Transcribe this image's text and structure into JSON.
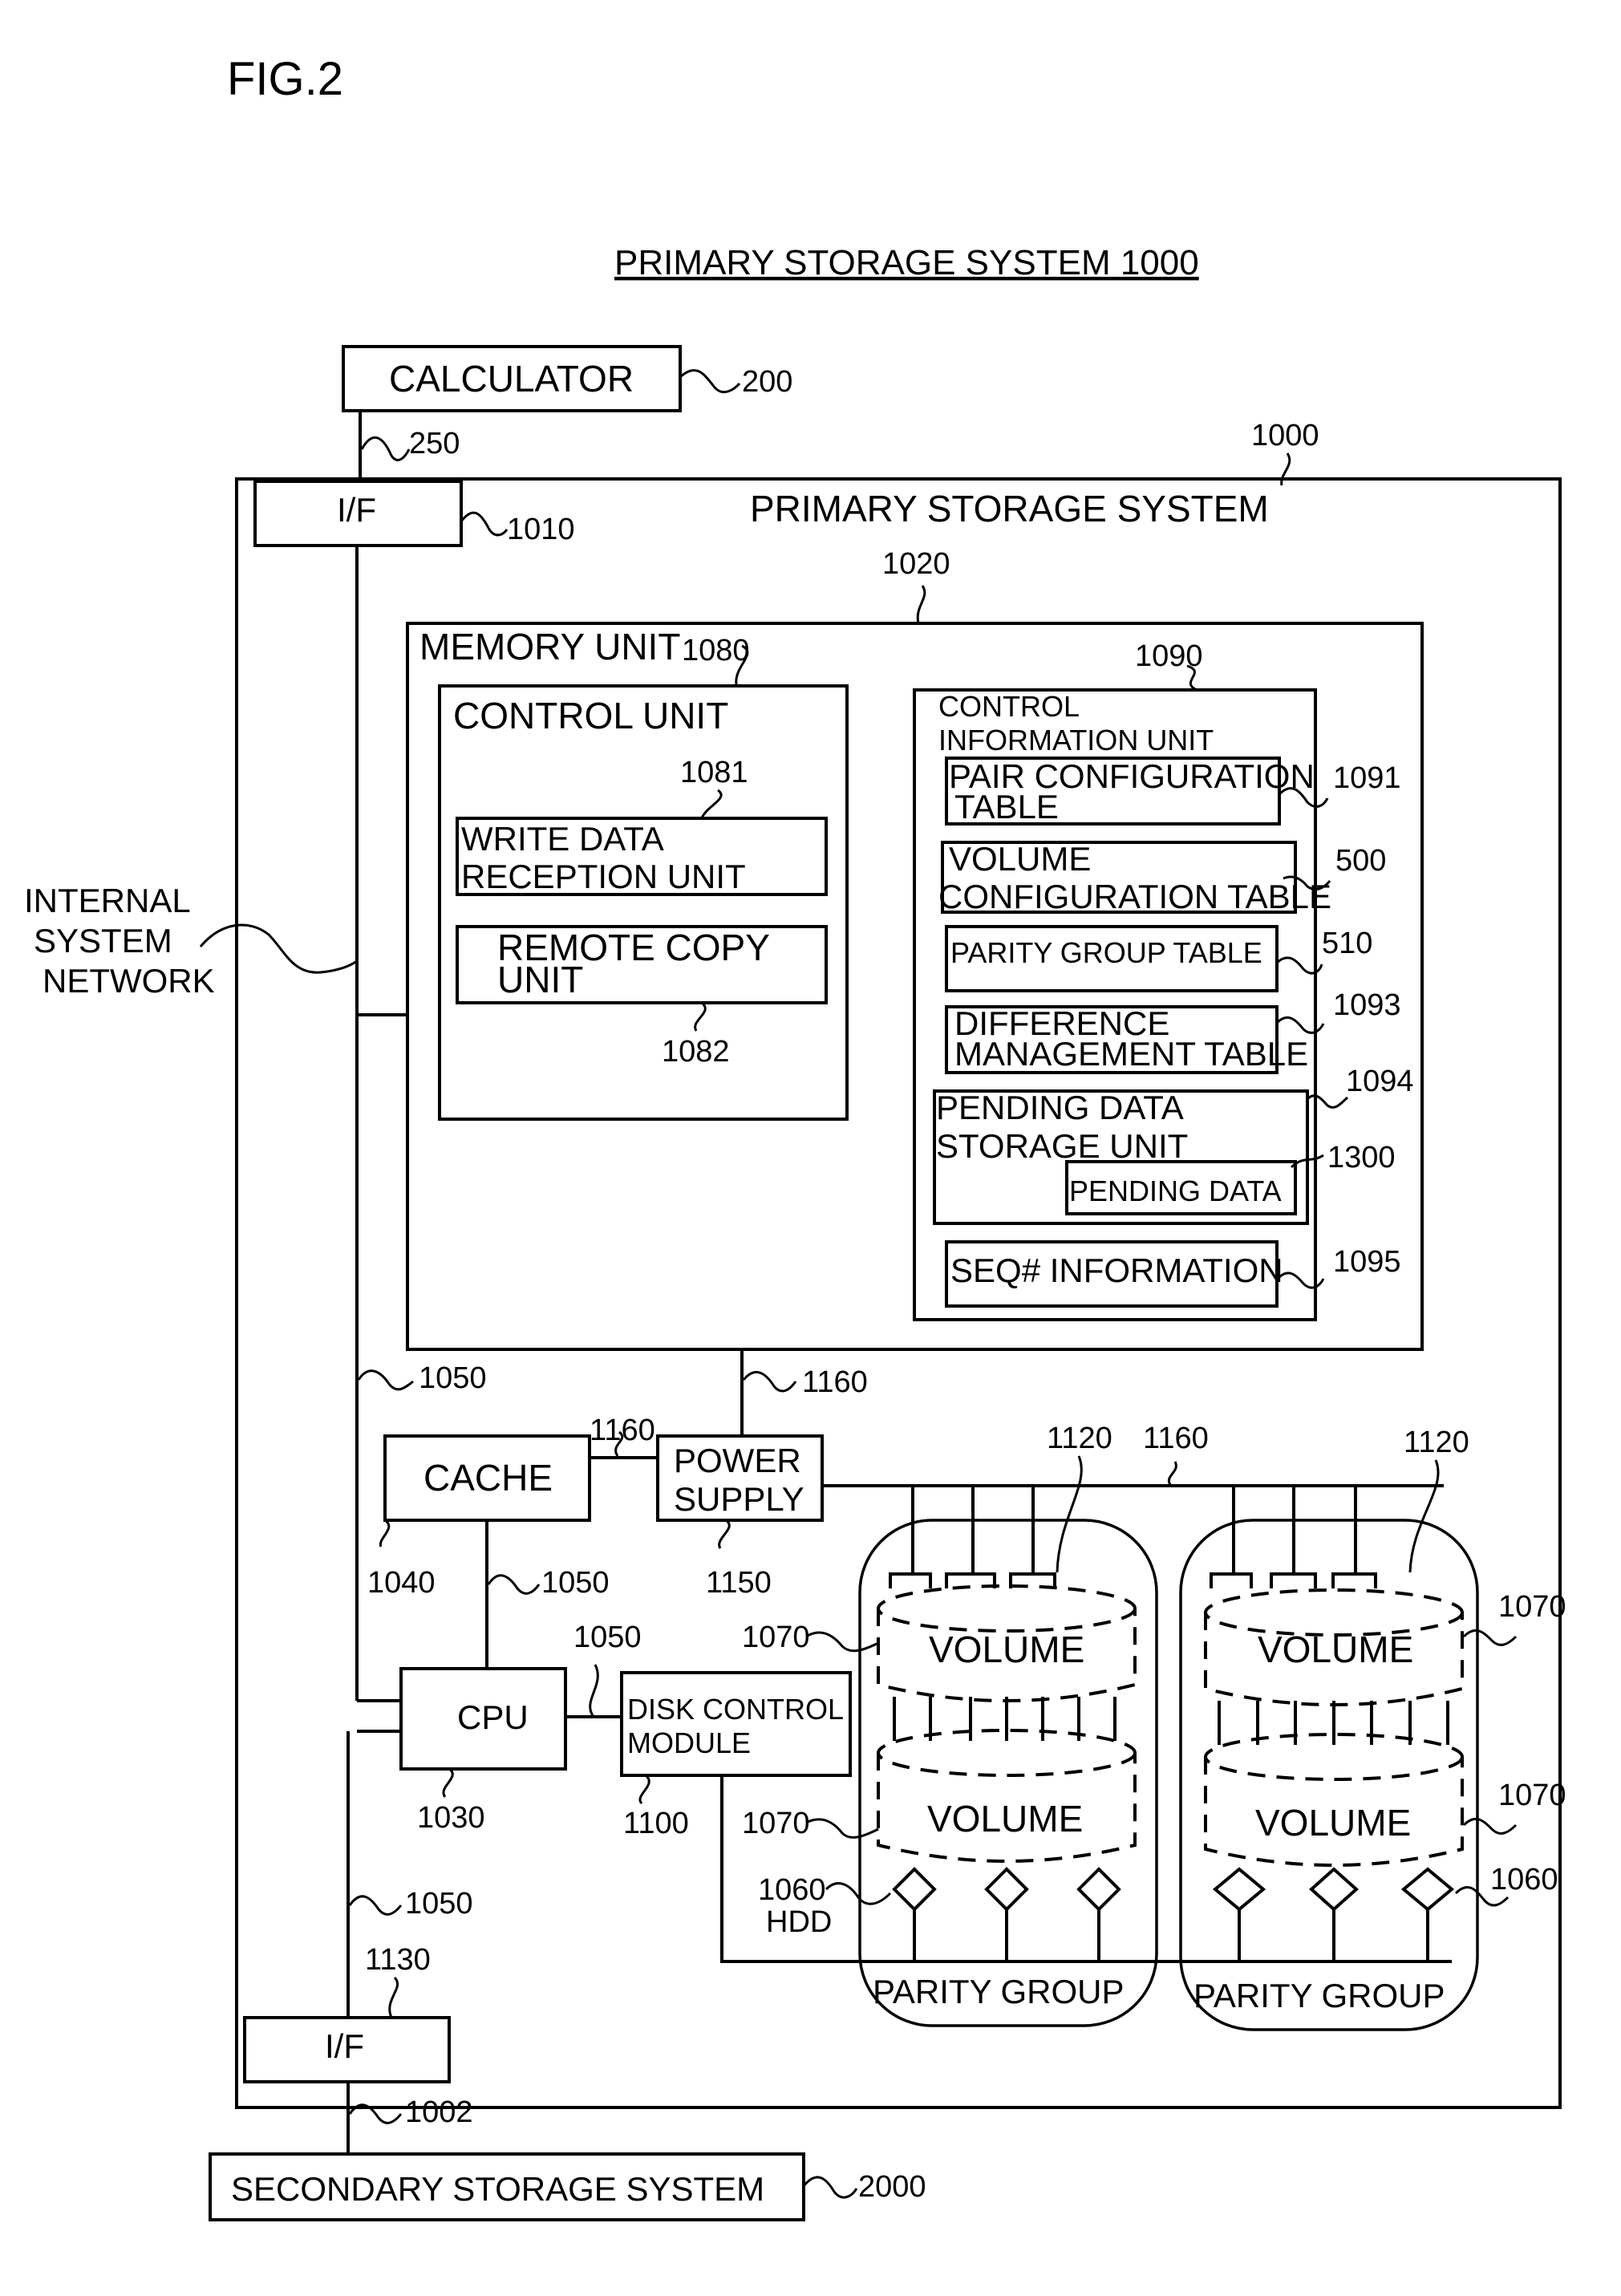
{
  "figure_label": "FIG.2",
  "title": "PRIMARY STORAGE SYSTEM 1000",
  "calculator": {
    "label": "CALCULATOR",
    "ref": "200",
    "link_ref": "250"
  },
  "primary_storage": {
    "label": "PRIMARY STORAGE SYSTEM",
    "ref": "1000",
    "if_top": {
      "label": "I/F",
      "ref": "1010"
    },
    "if_bottom": {
      "label": "I/F",
      "ref": "1130"
    },
    "internal_network": {
      "line1": "INTERNAL",
      "line2": "SYSTEM",
      "line3": "NETWORK"
    },
    "memory_unit": {
      "label": "MEMORY UNIT",
      "ref": "1020",
      "control_unit": {
        "label": "CONTROL UNIT",
        "ref": "1080",
        "write_data": {
          "line1": "WRITE DATA",
          "line2": "RECEPTION   UNIT",
          "ref": "1081"
        },
        "remote_copy": {
          "line1": "REMOTE COPY",
          "line2": "UNIT",
          "ref": "1082"
        }
      },
      "control_info": {
        "line1": "CONTROL",
        "line2": "INFORMATION UNIT",
        "ref": "1090",
        "items": [
          {
            "line1": "PAIR CONFIGURATION",
            "line2": "TABLE",
            "ref": "1091"
          },
          {
            "line1": "VOLUME",
            "line2": "CONFIGURATION TABLE",
            "ref": "500"
          },
          {
            "line1": "PARITY GROUP TABLE",
            "line2": "",
            "ref": "510"
          },
          {
            "line1": "DIFFERENCE",
            "line2": "MANAGEMENT TABLE",
            "ref": "1093"
          }
        ],
        "pending_storage": {
          "line1": "PENDING DATA",
          "line2": "STORAGE UNIT",
          "ref": "1094"
        },
        "pending_data": {
          "label": "PENDING DATA",
          "ref": "1300"
        },
        "seq_info": {
          "label": "SEQ# INFORMATION",
          "ref": "1095"
        }
      }
    },
    "bus_refs": {
      "a": "1050",
      "b": "1050",
      "c": "1050",
      "d": "1050"
    },
    "power_refs": {
      "a": "1160",
      "b": "1160",
      "c": "1160"
    },
    "cache": {
      "label": "CACHE",
      "ref": "1040"
    },
    "power_supply": {
      "line1": "POWER",
      "line2": "SUPPLY",
      "ref": "1150"
    },
    "cpu": {
      "label": "CPU",
      "ref": "1030"
    },
    "disk_control": {
      "line1": "DISK CONTROL",
      "line2": "MODULE",
      "ref": "1100"
    },
    "parity_groups": [
      {
        "label": "PARITY GROUP",
        "volume_top": "VOLUME",
        "volume_bottom": "VOLUME",
        "fan_ref": "1120",
        "vol_ref_top": "1070",
        "vol_ref_bottom": "1070",
        "hdd_ref": "1060",
        "hdd_label": "HDD"
      },
      {
        "label": "PARITY GROUP",
        "volume_top": "VOLUME",
        "volume_bottom": "VOLUME",
        "fan_ref": "1120",
        "vol_ref_top": "1070",
        "vol_ref_bottom": "1070",
        "hdd_ref": "1060"
      }
    ]
  },
  "secondary_storage": {
    "label": "SECONDARY STORAGE SYSTEM",
    "ref": "2000",
    "link_ref": "1002"
  }
}
